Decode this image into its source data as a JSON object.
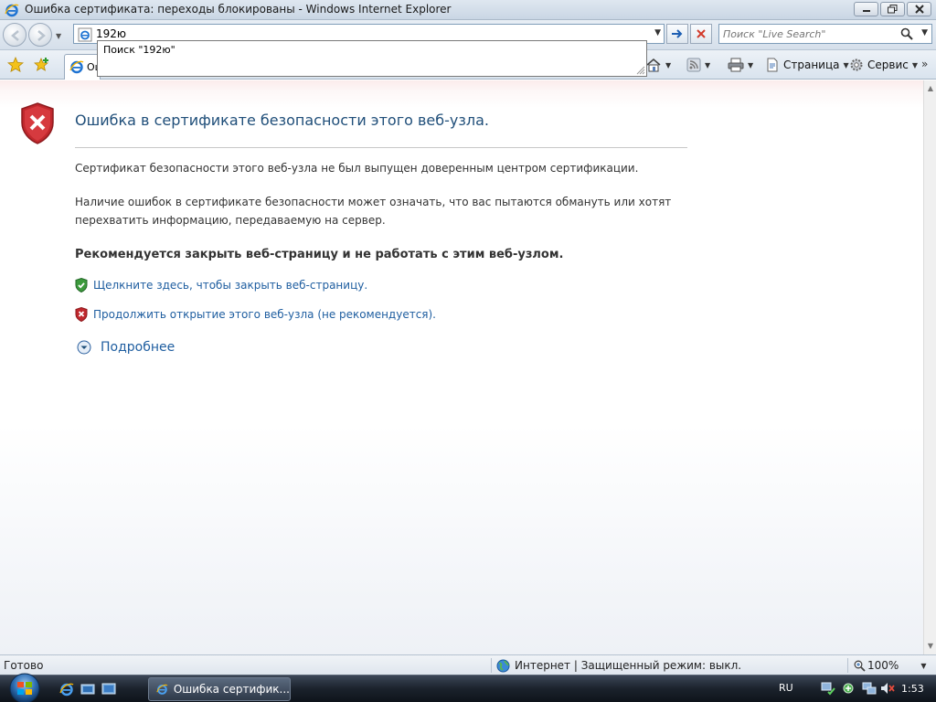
{
  "window": {
    "title": "Ошибка сертификата: переходы блокированы - Windows Internet Explorer"
  },
  "navbar": {
    "address_value": "192ю",
    "search_placeholder": "Поиск \"Live Search\""
  },
  "autocomplete": {
    "item": "Поиск \"192ю\""
  },
  "tabs": [
    {
      "label": "Ош"
    }
  ],
  "commandbar": {
    "page_label": "Страница",
    "tools_label": "Сервис"
  },
  "content": {
    "title": "Ошибка в сертификате безопасности этого веб-узла.",
    "para1": "Сертификат безопасности этого веб-узла не был выпущен доверенным центром сертификации.",
    "para2": "Наличие ошибок в сертификате безопасности может означать, что вас пытаются обмануть или хотят перехватить информацию, передаваемую на сервер.",
    "recommend": "Рекомендуется закрыть веб-страницу и не работать с этим веб-узлом.",
    "close_link": "Щелкните здесь, чтобы закрыть веб-страницу.",
    "continue_link": "Продолжить открытие этого веб-узла (не рекомендуется).",
    "more_info": "Подробнее"
  },
  "statusbar": {
    "status": "Готово",
    "zone": "Интернет | Защищенный режим: выкл.",
    "zoom": "100%"
  },
  "taskbar": {
    "task_label": "Ошибка сертифик...",
    "language": "RU",
    "clock": "1:53"
  },
  "colors": {
    "link": "#1f5ea0",
    "title": "#1f4e79",
    "error_shield": "#c0282d",
    "ok_shield": "#3c9a3c"
  }
}
